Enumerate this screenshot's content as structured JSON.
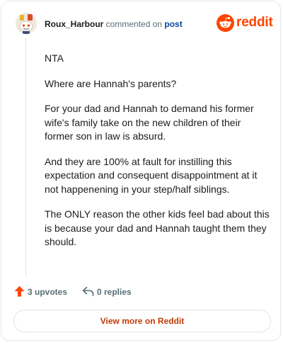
{
  "header": {
    "username": "Roux_Harbour",
    "action_text": " commented on ",
    "post_link": "post",
    "brand_word": "reddit"
  },
  "comment": {
    "paragraphs": [
      "NTA",
      "Where are Hannah's parents?",
      "For your dad and Hannah to demand his former wife's family take on the new children of their former son in law is absurd.",
      "And they are 100% at fault for instilling this expectation and consequent disappointment at it not happenening in your step/half siblings.",
      "The ONLY reason the other kids feel bad about this is because your dad and Hannah taught them they should."
    ]
  },
  "footer": {
    "upvotes_label": "3 upvotes",
    "replies_label": "0 replies",
    "view_button_label": "View more on Reddit"
  },
  "colors": {
    "brand": "#ff4500",
    "link": "#0a449b",
    "button_text": "#c23a04"
  },
  "icons": [
    "avatar-icon",
    "reddit-logo-icon",
    "upvote-arrow-icon",
    "reply-arrow-icon"
  ]
}
